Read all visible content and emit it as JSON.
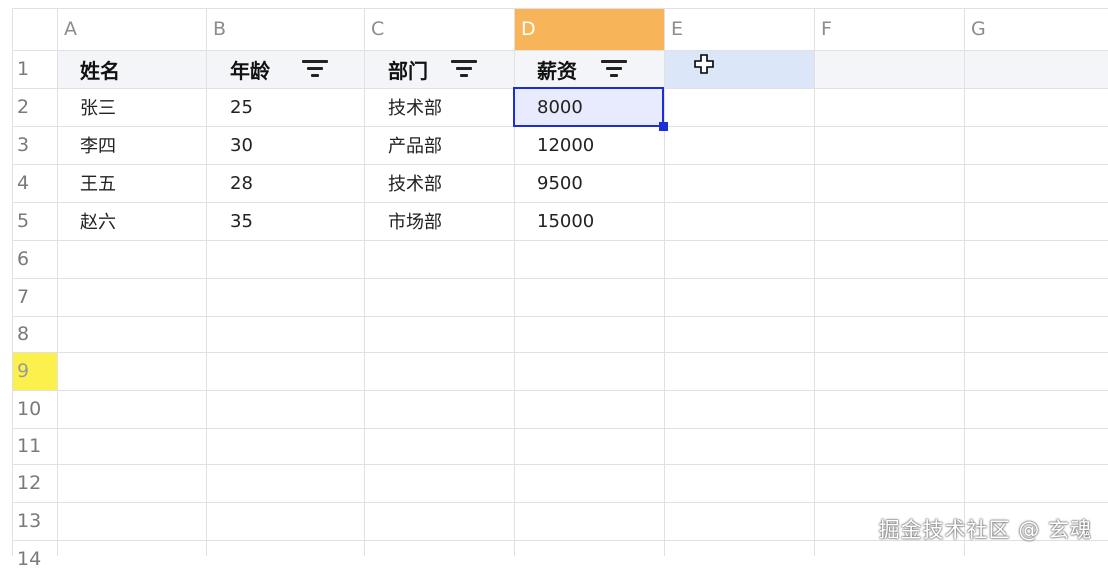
{
  "columns": [
    "A",
    "B",
    "C",
    "D",
    "E",
    "F",
    "G"
  ],
  "active_column": "D",
  "rows": [
    "1",
    "2",
    "3",
    "4",
    "5",
    "6",
    "7",
    "8",
    "9",
    "10",
    "11",
    "12",
    "13",
    "14"
  ],
  "active_row": "9",
  "header": {
    "name": "姓名",
    "age": "年龄",
    "dept": "部门",
    "salary": "薪资"
  },
  "records": [
    {
      "name": "张三",
      "age": "25",
      "dept": "技术部",
      "salary": "8000"
    },
    {
      "name": "李四",
      "age": "30",
      "dept": "产品部",
      "salary": "12000"
    },
    {
      "name": "王五",
      "age": "28",
      "dept": "技术部",
      "salary": "9500"
    },
    {
      "name": "赵六",
      "age": "35",
      "dept": "市场部",
      "salary": "15000"
    }
  ],
  "selected_cell": "D2",
  "watermark": "掘金技术社区 @ 玄魂",
  "colors": {
    "active_column_header": "#f7b459",
    "active_row_header": "#fbf04c",
    "selection_border": "#1c2fd6",
    "e1_highlight": "#dbe6f8"
  },
  "icons": [
    "filter-icon",
    "move-cursor-icon"
  ]
}
